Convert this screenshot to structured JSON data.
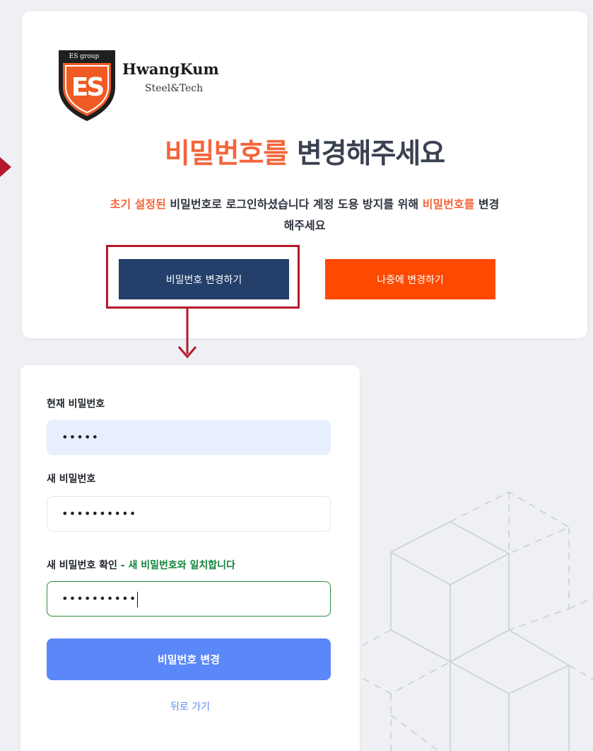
{
  "logo": {
    "group_text": "ES group",
    "letters": "ES",
    "name": "HwangKum",
    "sub": "Steel&Tech"
  },
  "headline": {
    "accent": "비밀번호를",
    "rest": " 변경해주세요"
  },
  "description": {
    "accent1": "초기 설정된",
    "text1": " 비밀번호로 로그인하셨습니다 계정 도용 방지를 위해 ",
    "accent2": "비밀번호를",
    "text2": " 변경해주세요"
  },
  "buttons": {
    "change": "비밀번호 변경하기",
    "later": "나중에 변경하기"
  },
  "form": {
    "current_label": "현재 비밀번호",
    "current_value": "•••••",
    "new_label": "새 비밀번호",
    "new_value": "••••••••••",
    "confirm_label": "새 비밀번호 확인",
    "confirm_status": " - 새 비밀번호와 일치합니다",
    "confirm_value": "••••••••••",
    "submit": "비밀번호 변경",
    "back": "뒤로 가기"
  },
  "colors": {
    "accent_orange": "#f4653b",
    "navy": "#233f6a",
    "orange_button": "#fe4a00",
    "blue_button": "#5b88f8",
    "highlight_red": "#b5192b",
    "success_green": "#12833a"
  }
}
